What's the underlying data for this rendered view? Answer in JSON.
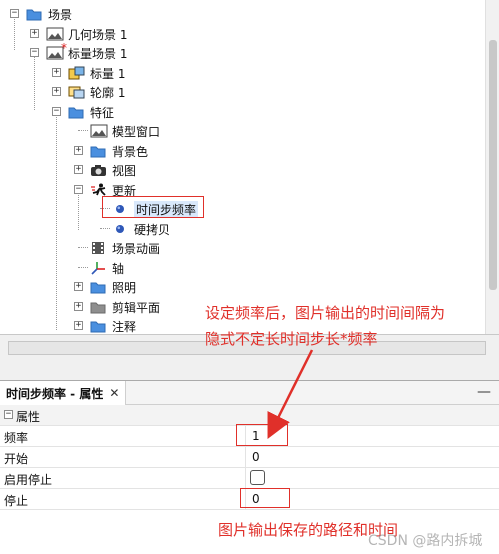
{
  "tree": {
    "items": [
      {
        "label": "场景",
        "level": 0,
        "expander": "−",
        "icon": "folder-icon"
      },
      {
        "label": "几何场景 1",
        "level": 1,
        "expander": "+",
        "icon": "image-icon"
      },
      {
        "label": "标量场景 1",
        "level": 1,
        "expander": "−",
        "icon": "image-icon",
        "prefix": "*"
      },
      {
        "label": "标量 1",
        "level": 2,
        "expander": "+",
        "icon": "scalar-icon"
      },
      {
        "label": "轮廓 1",
        "level": 2,
        "expander": "+",
        "icon": "contour-icon"
      },
      {
        "label": "特征",
        "level": 2,
        "expander": "−",
        "icon": "folder-icon"
      },
      {
        "label": "模型窗口",
        "level": 3,
        "expander": "",
        "icon": "image-icon"
      },
      {
        "label": "背景色",
        "level": 3,
        "expander": "+",
        "icon": "folder-icon"
      },
      {
        "label": "视图",
        "level": 3,
        "expander": "+",
        "icon": "camera-icon"
      },
      {
        "label": "更新",
        "level": 3,
        "expander": "−",
        "icon": "runner-icon"
      },
      {
        "label": "时间步频率",
        "level": 4,
        "expander": "",
        "icon": "dot-icon",
        "selected": true
      },
      {
        "label": "硬拷贝",
        "level": 4,
        "expander": "",
        "icon": "dot-icon"
      },
      {
        "label": "场景动画",
        "level": 3,
        "expander": "",
        "icon": "film-icon"
      },
      {
        "label": "轴",
        "level": 3,
        "expander": "",
        "icon": "axis-icon"
      },
      {
        "label": "照明",
        "level": 3,
        "expander": "+",
        "icon": "folder-icon"
      },
      {
        "label": "剪辑平面",
        "level": 3,
        "expander": "+",
        "icon": "folder-gray-icon"
      },
      {
        "label": "注释",
        "level": 3,
        "expander": "+",
        "icon": "folder-icon"
      }
    ]
  },
  "properties": {
    "tab_title": "时间步频率 - 属性",
    "close_glyph": "✕",
    "minimize_glyph": "—",
    "group_label": "属性",
    "group_expander": "−",
    "rows": [
      {
        "name": "频率",
        "value": "1"
      },
      {
        "name": "开始",
        "value": "0"
      },
      {
        "name": "启用停止",
        "value": ""
      },
      {
        "name": "停止",
        "value": "0"
      }
    ]
  },
  "annotations": {
    "line1": "设定频率后，图片输出的时间间隔为",
    "line2": "隐式不定长时间步长*频率",
    "bottom": "图片输出保存的路径和时间"
  },
  "watermark": "CSDN @路内拆城",
  "colors": {
    "accent_red": "#e0302a",
    "folder_blue": "#4a8fdf",
    "selection": "#d9e8fb"
  }
}
